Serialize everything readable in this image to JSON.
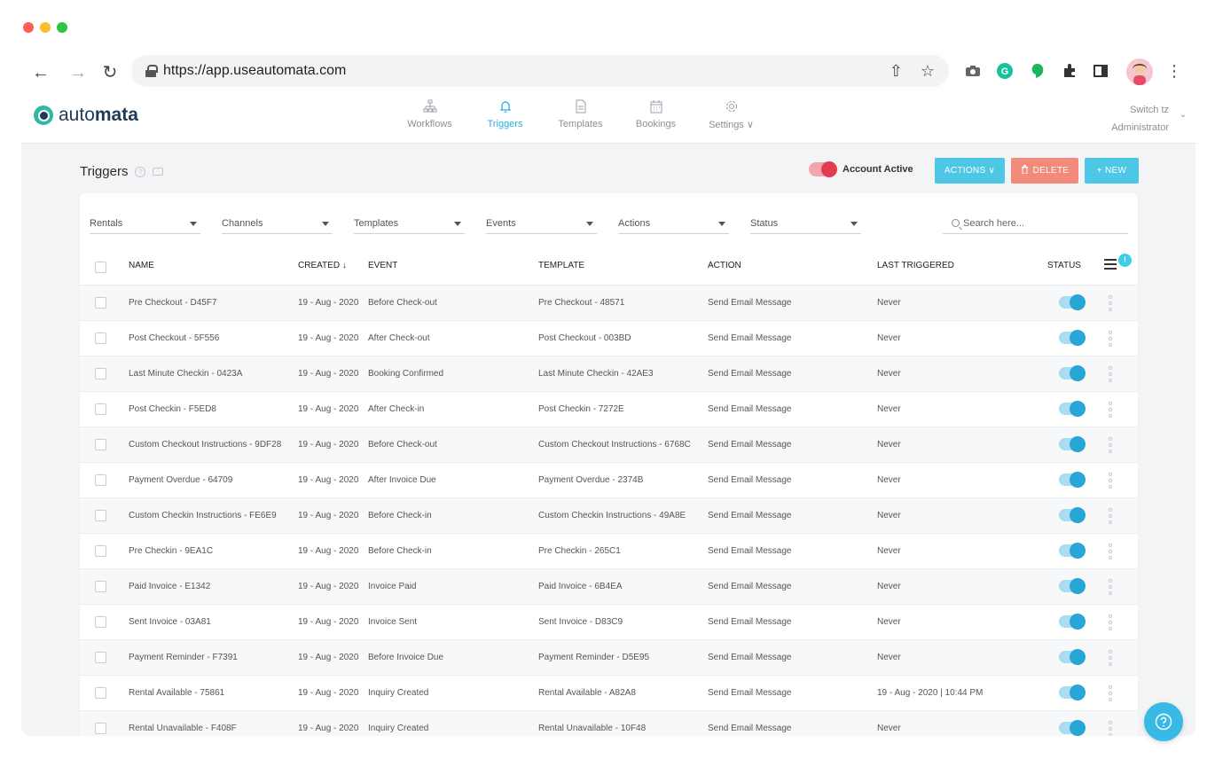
{
  "browser": {
    "url": "https://app.useautomata.com"
  },
  "app": {
    "logo_text_light": "auto",
    "logo_text_bold": "mata",
    "nav": [
      {
        "label": "Workflows",
        "icon": "sitemap-icon"
      },
      {
        "label": "Triggers",
        "icon": "bell-icon",
        "active": true
      },
      {
        "label": "Templates",
        "icon": "document-icon"
      },
      {
        "label": "Bookings",
        "icon": "calendar-icon"
      },
      {
        "label": "Settings ∨",
        "icon": "gear-icon"
      }
    ],
    "user": {
      "line1": "Switch tz",
      "line2": "Administrator"
    }
  },
  "page": {
    "title": "Triggers",
    "account_status_label": "Account Active",
    "actions_label": "ACTIONS ∨",
    "delete_label": "DELETE",
    "new_label": "+ NEW"
  },
  "filters": {
    "rentals": "Rentals",
    "channels": "Channels",
    "templates": "Templates",
    "events": "Events",
    "actions": "Actions",
    "status": "Status",
    "search_placeholder": "Search here..."
  },
  "columns": {
    "name": "NAME",
    "created": "CREATED ↓",
    "event": "EVENT",
    "template": "TEMPLATE",
    "action": "ACTION",
    "last_triggered": "LAST TRIGGERED",
    "status": "STATUS",
    "badge": "!"
  },
  "rows": [
    {
      "name": "Pre Checkout - D45F7",
      "created": "19 - Aug - 2020",
      "event": "Before Check-out",
      "template": "Pre Checkout - 48571",
      "action": "Send Email Message",
      "last": "Never",
      "active": true
    },
    {
      "name": "Post Checkout - 5F556",
      "created": "19 - Aug - 2020",
      "event": "After Check-out",
      "template": "Post Checkout - 003BD",
      "action": "Send Email Message",
      "last": "Never",
      "active": true
    },
    {
      "name": "Last Minute Checkin - 0423A",
      "created": "19 - Aug - 2020",
      "event": "Booking Confirmed",
      "template": "Last Minute Checkin - 42AE3",
      "action": "Send Email Message",
      "last": "Never",
      "active": true
    },
    {
      "name": "Post Checkin - F5ED8",
      "created": "19 - Aug - 2020",
      "event": "After Check-in",
      "template": "Post Checkin - 7272E",
      "action": "Send Email Message",
      "last": "Never",
      "active": true
    },
    {
      "name": "Custom Checkout Instructions - 9DF28",
      "created": "19 - Aug - 2020",
      "event": "Before Check-out",
      "template": "Custom Checkout Instructions - 6768C",
      "action": "Send Email Message",
      "last": "Never",
      "active": true
    },
    {
      "name": "Payment Overdue - 64709",
      "created": "19 - Aug - 2020",
      "event": "After Invoice Due",
      "template": "Payment Overdue - 2374B",
      "action": "Send Email Message",
      "last": "Never",
      "active": true
    },
    {
      "name": "Custom Checkin Instructions - FE6E9",
      "created": "19 - Aug - 2020",
      "event": "Before Check-in",
      "template": "Custom Checkin Instructions - 49A8E",
      "action": "Send Email Message",
      "last": "Never",
      "active": true
    },
    {
      "name": "Pre Checkin - 9EA1C",
      "created": "19 - Aug - 2020",
      "event": "Before Check-in",
      "template": "Pre Checkin - 265C1",
      "action": "Send Email Message",
      "last": "Never",
      "active": true
    },
    {
      "name": "Paid Invoice - E1342",
      "created": "19 - Aug - 2020",
      "event": "Invoice Paid",
      "template": "Paid Invoice - 6B4EA",
      "action": "Send Email Message",
      "last": "Never",
      "active": true
    },
    {
      "name": "Sent Invoice - 03A81",
      "created": "19 - Aug - 2020",
      "event": "Invoice Sent",
      "template": "Sent Invoice - D83C9",
      "action": "Send Email Message",
      "last": "Never",
      "active": true
    },
    {
      "name": "Payment Reminder - F7391",
      "created": "19 - Aug - 2020",
      "event": "Before Invoice Due",
      "template": "Payment Reminder - D5E95",
      "action": "Send Email Message",
      "last": "Never",
      "active": true
    },
    {
      "name": "Rental Available - 75861",
      "created": "19 - Aug - 2020",
      "event": "Inquiry Created",
      "template": "Rental Available - A82A8",
      "action": "Send Email Message",
      "last": "19 - Aug - 2020 | 10:44 PM",
      "active": true
    },
    {
      "name": "Rental Unavailable - F408F",
      "created": "19 - Aug - 2020",
      "event": "Inquiry Created",
      "template": "Rental Unavailable - 10F48",
      "action": "Send Email Message",
      "last": "Never",
      "active": true
    }
  ],
  "colors": {
    "accent": "#2aaee0",
    "delete": "#f28b7b",
    "account_toggle": "#e23d4e"
  }
}
